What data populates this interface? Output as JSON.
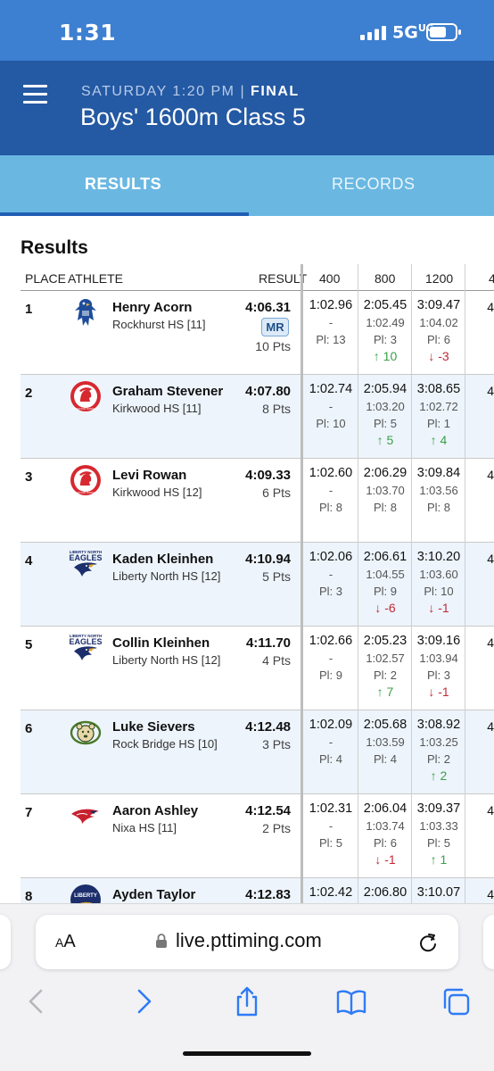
{
  "status": {
    "time": "1:31",
    "network": "5G",
    "network_sup": "UC"
  },
  "header": {
    "day_time": "SATURDAY 1:20 PM | ",
    "status": "FINAL",
    "title": "Boys' 1600m Class 5"
  },
  "tabs": [
    {
      "label": "RESULTS",
      "active": true
    },
    {
      "label": "RECORDS",
      "active": false
    }
  ],
  "results": {
    "title": "Results",
    "columns": {
      "place": "PLACE",
      "athlete": "ATHLETE",
      "result": "RESULT",
      "split1": "400",
      "split2": "800",
      "split3": "1200",
      "split4": "4"
    },
    "rows": [
      {
        "place": "1",
        "name": "Henry Acorn",
        "team": "Rockhurst HS [11]",
        "mark": "4:06.31",
        "badge": "MR",
        "pts": "10 Pts",
        "s400": {
          "t": "1:02.96",
          "s": "-",
          "p": "Pl: 13"
        },
        "s800": {
          "t": "2:05.45",
          "s": "1:02.49",
          "p": "Pl: 3",
          "c": "↑ 10",
          "dir": "up"
        },
        "s1200": {
          "t": "3:09.47",
          "s": "1:04.02",
          "p": "Pl: 6",
          "c": "↓ -3",
          "dir": "down"
        },
        "edge": "4"
      },
      {
        "place": "2",
        "name": "Graham Stevener",
        "team": "Kirkwood HS [11]",
        "mark": "4:07.80",
        "pts": "8 Pts",
        "s400": {
          "t": "1:02.74",
          "s": "-",
          "p": "Pl: 10"
        },
        "s800": {
          "t": "2:05.94",
          "s": "1:03.20",
          "p": "Pl: 5",
          "c": "↑ 5",
          "dir": "up"
        },
        "s1200": {
          "t": "3:08.65",
          "s": "1:02.72",
          "p": "Pl: 1",
          "c": "↑ 4",
          "dir": "up"
        },
        "edge": "4"
      },
      {
        "place": "3",
        "name": "Levi Rowan",
        "team": "Kirkwood HS [12]",
        "mark": "4:09.33",
        "pts": "6 Pts",
        "s400": {
          "t": "1:02.60",
          "s": "-",
          "p": "Pl: 8"
        },
        "s800": {
          "t": "2:06.29",
          "s": "1:03.70",
          "p": "Pl: 8"
        },
        "s1200": {
          "t": "3:09.84",
          "s": "1:03.56",
          "p": "Pl: 8"
        },
        "edge": "4"
      },
      {
        "place": "4",
        "name": "Kaden Kleinhen",
        "team": "Liberty North HS [12]",
        "mark": "4:10.94",
        "pts": "5 Pts",
        "s400": {
          "t": "1:02.06",
          "s": "-",
          "p": "Pl: 3"
        },
        "s800": {
          "t": "2:06.61",
          "s": "1:04.55",
          "p": "Pl: 9",
          "c": "↓ -6",
          "dir": "down"
        },
        "s1200": {
          "t": "3:10.20",
          "s": "1:03.60",
          "p": "Pl: 10",
          "c": "↓ -1",
          "dir": "down"
        },
        "edge": "4"
      },
      {
        "place": "5",
        "name": "Collin Kleinhen",
        "team": "Liberty North HS [12]",
        "mark": "4:11.70",
        "pts": "4 Pts",
        "s400": {
          "t": "1:02.66",
          "s": "-",
          "p": "Pl: 9"
        },
        "s800": {
          "t": "2:05.23",
          "s": "1:02.57",
          "p": "Pl: 2",
          "c": "↑ 7",
          "dir": "up"
        },
        "s1200": {
          "t": "3:09.16",
          "s": "1:03.94",
          "p": "Pl: 3",
          "c": "↓ -1",
          "dir": "down"
        },
        "edge": "4"
      },
      {
        "place": "6",
        "name": "Luke Sievers",
        "team": "Rock Bridge HS [10]",
        "mark": "4:12.48",
        "pts": "3 Pts",
        "s400": {
          "t": "1:02.09",
          "s": "-",
          "p": "Pl: 4"
        },
        "s800": {
          "t": "2:05.68",
          "s": "1:03.59",
          "p": "Pl: 4"
        },
        "s1200": {
          "t": "3:08.92",
          "s": "1:03.25",
          "p": "Pl: 2",
          "c": "↑ 2",
          "dir": "up"
        },
        "edge": "4"
      },
      {
        "place": "7",
        "name": "Aaron Ashley",
        "team": "Nixa HS [11]",
        "mark": "4:12.54",
        "pts": "2 Pts",
        "s400": {
          "t": "1:02.31",
          "s": "-",
          "p": "Pl: 5"
        },
        "s800": {
          "t": "2:06.04",
          "s": "1:03.74",
          "p": "Pl: 6",
          "c": "↓ -1",
          "dir": "down"
        },
        "s1200": {
          "t": "3:09.37",
          "s": "1:03.33",
          "p": "Pl: 5",
          "c": "↑ 1",
          "dir": "up"
        },
        "edge": "4"
      },
      {
        "place": "8",
        "name": "Ayden Taylor",
        "team": "",
        "mark": "4:12.83",
        "pts": "",
        "s400": {
          "t": "1:02.42",
          "s": "",
          "p": ""
        },
        "s800": {
          "t": "2:06.80",
          "s": "",
          "p": ""
        },
        "s1200": {
          "t": "3:10.07",
          "s": "",
          "p": ""
        },
        "edge": "4"
      }
    ],
    "logos": [
      "rockhurst-hawk",
      "kirkwood-pioneer",
      "kirkwood-pioneer",
      "liberty-north-eagles",
      "liberty-north-eagles",
      "rock-bridge-bruin",
      "nixa-eagle",
      "liberty-eagle"
    ],
    "logo_texts": {
      "kirkwood": "KIRKWOOD PIONEERS",
      "liberty": "LIBERTY NORTH",
      "eagles": "EAGLES",
      "liberty2": "LIBERTY"
    }
  },
  "safari": {
    "text_size": "A",
    "text_size_small": "A",
    "url": "live.pttiming.com"
  },
  "colors": {
    "header": "#2459a3",
    "status": "#3d7fd0",
    "tabs": "#6ab8e2",
    "up": "#3aa04a",
    "down": "#c22a37"
  }
}
